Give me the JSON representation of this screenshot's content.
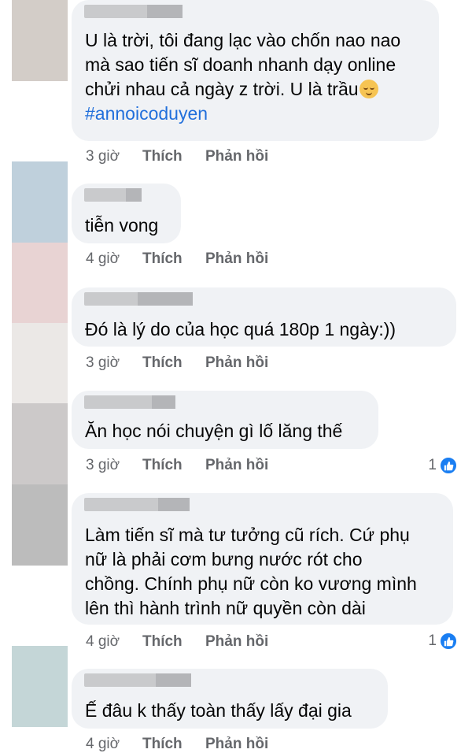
{
  "colors": {
    "bubble": "#f0f2f5",
    "hashtag": "#216fdb",
    "meta_text": "#65676b",
    "like_reaction": "#1a7ef2"
  },
  "comments": [
    {
      "avatar_color": "#d3cdc8",
      "text": "U là trời, tôi đang lạc vào chốn nao nao\nmà sao tiến sĩ doanh nhanh dạy online\nchửi nhau cả ngày z trời. U là trầu",
      "emoji": "relieved-face-emoji",
      "hashtag": "#annoicoduyen",
      "time": "3 giờ",
      "like": "Thích",
      "reply": "Phản hồi"
    },
    {
      "avatar_color": "#bfd0dc",
      "text": "tiễn vong",
      "time": "4 giờ",
      "like": "Thích",
      "reply": "Phản hồi"
    },
    {
      "avatar_color": "#e8d3d3",
      "text": "Đó là lý do của học quá 180p 1 ngày:))",
      "time": "3 giờ",
      "like": "Thích",
      "reply": "Phản hồi"
    },
    {
      "avatar_color": "#ccc9c9",
      "text": "Ăn học nói chuyện gì lố lăng thế",
      "time": "3 giờ",
      "like": "Thích",
      "reply": "Phản hồi",
      "reaction_count": "1"
    },
    {
      "avatar_color": "#bcbcbc",
      "text": "Làm tiến sĩ mà tư tưởng cũ rích. Cứ phụ\nnữ là phải cơm bưng nước rót cho\nchồng. Chính phụ nữ còn ko vương mình\nlên thì hành trình nữ quyền còn dài",
      "time": "4 giờ",
      "like": "Thích",
      "reply": "Phản hồi",
      "reaction_count": "1"
    },
    {
      "avatar_color": "#c4d6d7",
      "text": "Ế đâu k thấy toàn thấy lấy đại gia",
      "time": "4 giờ",
      "like": "Thích",
      "reply": "Phản hồi"
    }
  ]
}
